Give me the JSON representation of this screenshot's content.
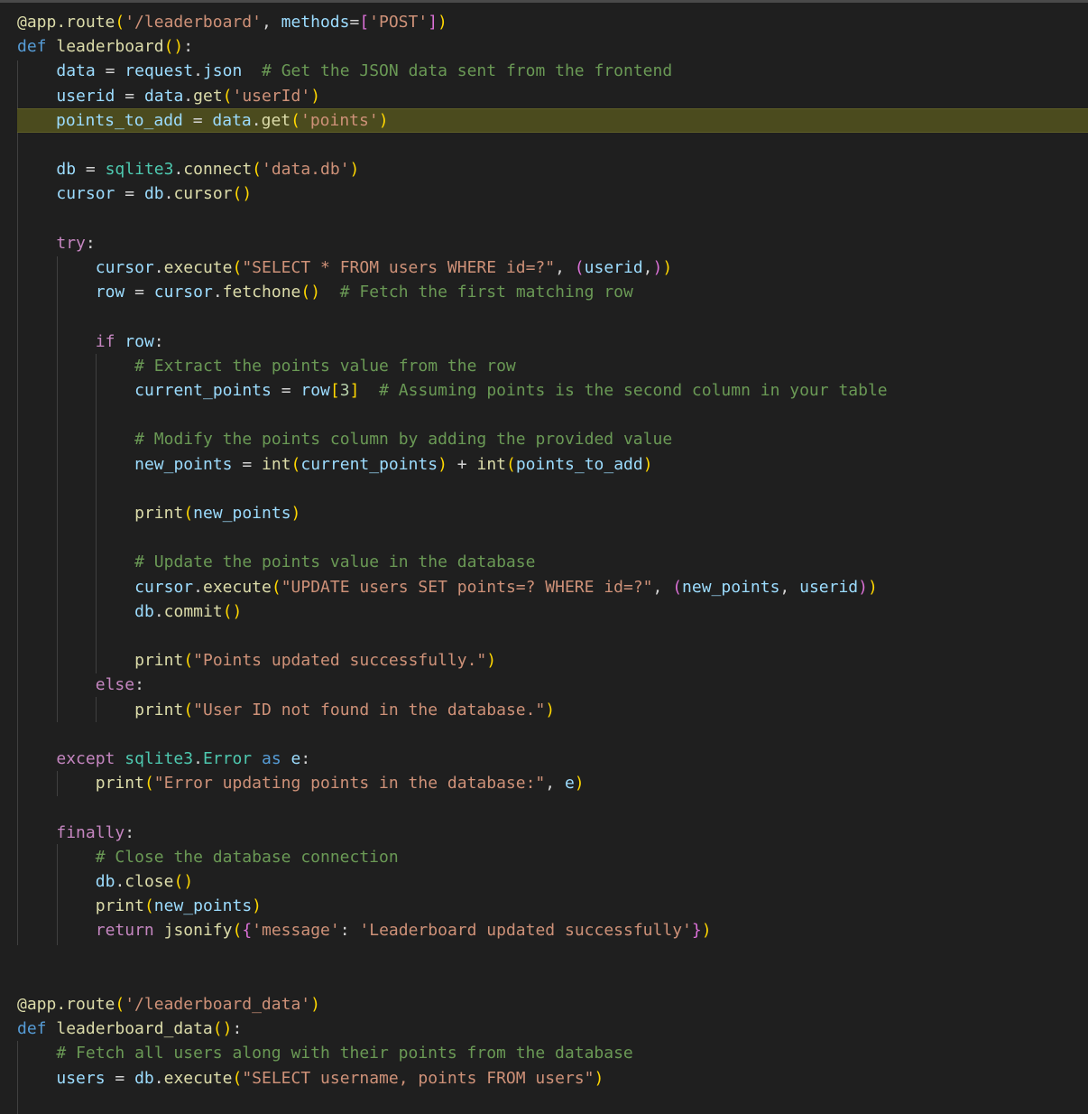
{
  "editor": {
    "language": "python",
    "colors": {
      "background": "#1f1f1f",
      "highlight": "#4b4b1e",
      "keyword": "#569cd6",
      "control": "#c586c0",
      "function": "#dcdcaa",
      "variable": "#9cdcfe",
      "string": "#ce9178",
      "comment": "#6a9955",
      "class": "#4ec9b0"
    },
    "highlighted_line": "points_to_add = data.get('points')",
    "lines": [
      "@app.route('/leaderboard', methods=['POST'])",
      "def leaderboard():",
      "    data = request.json  # Get the JSON data sent from the frontend",
      "    userid = data.get('userId')",
      "    points_to_add = data.get('points')",
      "",
      "    db = sqlite3.connect('data.db')",
      "    cursor = db.cursor()",
      "",
      "    try:",
      "        cursor.execute(\"SELECT * FROM users WHERE id=?\", (userid,))",
      "        row = cursor.fetchone()  # Fetch the first matching row",
      "",
      "        if row:",
      "            # Extract the points value from the row",
      "            current_points = row[3]  # Assuming points is the second column in your table",
      "",
      "            # Modify the points column by adding the provided value",
      "            new_points = int(current_points) + int(points_to_add)",
      "",
      "            print(new_points)",
      "",
      "            # Update the points value in the database",
      "            cursor.execute(\"UPDATE users SET points=? WHERE id=?\", (new_points, userid))",
      "            db.commit()",
      "",
      "            print(\"Points updated successfully.\")",
      "        else:",
      "            print(\"User ID not found in the database.\")",
      "",
      "    except sqlite3.Error as e:",
      "        print(\"Error updating points in the database:\", e)",
      "",
      "    finally:",
      "        # Close the database connection",
      "        db.close()",
      "        print(new_points)",
      "        return jsonify({'message': 'Leaderboard updated successfully'})",
      "",
      "",
      "@app.route('/leaderboard_data')",
      "def leaderboard_data():",
      "    # Fetch all users along with their points from the database",
      "    users = db.execute(\"SELECT username, points FROM users\")",
      ""
    ]
  }
}
